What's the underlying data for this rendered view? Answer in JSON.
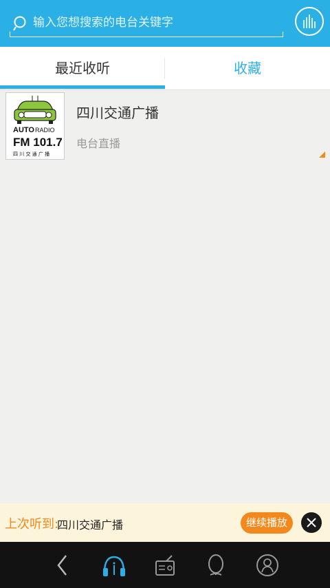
{
  "search": {
    "placeholder": "输入您想搜索的电台关键字",
    "icon": "search-icon",
    "voice_icon": "voice-equalizer-icon"
  },
  "tabs": [
    {
      "label": "最近收听",
      "active": true
    },
    {
      "label": "收藏",
      "active": false
    }
  ],
  "list": [
    {
      "title": "四川交通广播",
      "subtitle": "电台直播",
      "logo": {
        "line1": "AUTO",
        "line2": "RADIO",
        "line3": "FM 101.7",
        "line4": "四 川 交 通 广 播"
      }
    }
  ],
  "last_played": {
    "label": "上次听到:",
    "station": "四川交通广播",
    "continue_label": "继续播放"
  },
  "bottom_nav": [
    "back-icon",
    "headphones-icon",
    "radio-icon",
    "globe-icon",
    "user-icon"
  ],
  "colors": {
    "primary": "#2bb0e6",
    "accent": "#f3891c",
    "nav_bg": "#121212",
    "banner_bg": "#fdf4dc"
  }
}
